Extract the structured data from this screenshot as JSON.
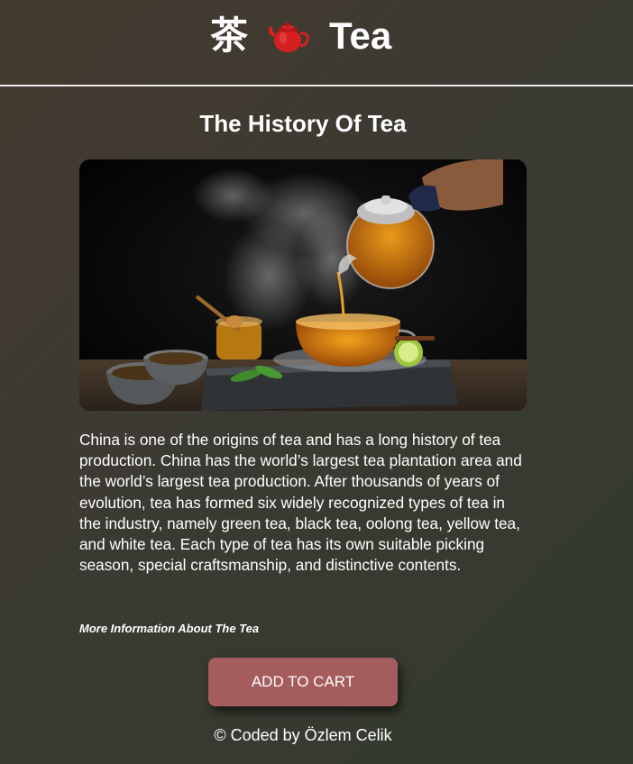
{
  "header": {
    "logo_hanzi": "茶",
    "logo_icon": "teapot-icon",
    "logo_word": "Tea"
  },
  "main": {
    "title": "The History Of Tea",
    "hero_image": "tea-pouring-photo",
    "paragraph": "China is one of the origins of tea and has a long history of tea production. China has the world’s largest tea plantation area and the world’s largest tea production. After thousands of years of evolution, tea has formed six widely recognized types of tea in the industry, namely green tea, black tea, oolong tea, yellow tea, and white tea. Each type of tea has its own suitable picking season, special craftsmanship, and distinctive contents.",
    "more_link": "More Information About The Tea",
    "cart_button": "ADD TO CART"
  },
  "footer": {
    "credit": "© Coded by Özlem Celik"
  },
  "colors": {
    "background_start": "#453a30",
    "background_end": "#323a2e",
    "button": "#a45c5c",
    "header_rule": "#e9e9e9",
    "text": "#ffffff"
  }
}
